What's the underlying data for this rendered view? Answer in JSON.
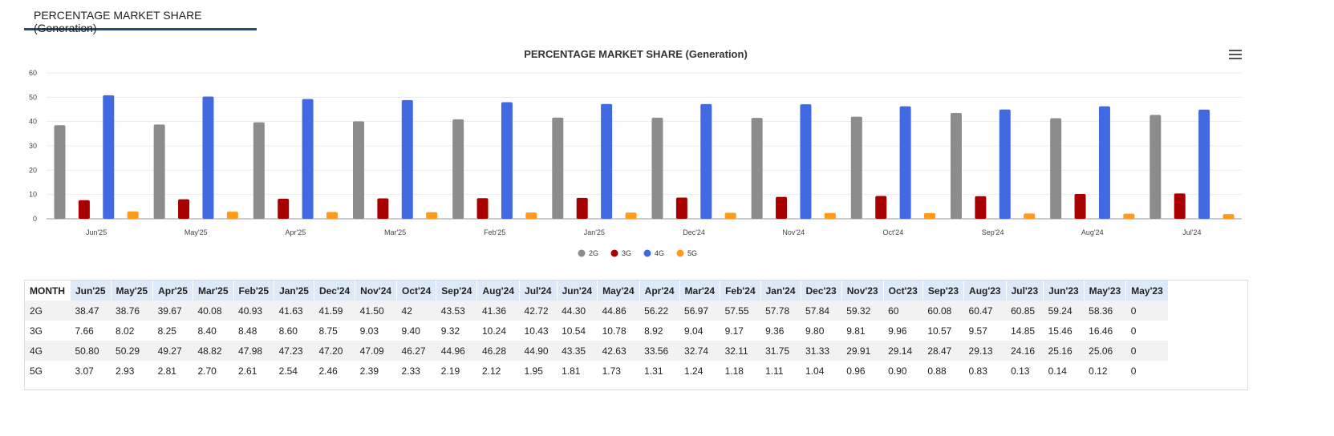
{
  "tab": {
    "label": "PERCENTAGE MARKET SHARE (Generation)"
  },
  "chart_data": {
    "type": "bar",
    "title": "PERCENTAGE MARKET SHARE (Generation)",
    "categories": [
      "Jun'25",
      "May'25",
      "Apr'25",
      "Mar'25",
      "Feb'25",
      "Jan'25",
      "Dec'24",
      "Nov'24",
      "Oct'24",
      "Sep'24",
      "Aug'24",
      "Jul'24"
    ],
    "series": [
      {
        "name": "2G",
        "color": "#8c8c8c",
        "values": [
          38.47,
          38.76,
          39.67,
          40.08,
          40.93,
          41.63,
          41.59,
          41.5,
          42,
          43.53,
          41.36,
          42.72
        ]
      },
      {
        "name": "3G",
        "color": "#a80000",
        "values": [
          7.66,
          8.02,
          8.25,
          8.4,
          8.48,
          8.6,
          8.75,
          9.03,
          9.4,
          9.32,
          10.24,
          10.43
        ]
      },
      {
        "name": "4G",
        "color": "#4169e1",
        "values": [
          50.8,
          50.29,
          49.27,
          48.82,
          47.98,
          47.23,
          47.2,
          47.09,
          46.27,
          44.96,
          46.28,
          44.9
        ]
      },
      {
        "name": "5G",
        "color": "#ff9a1a",
        "values": [
          3.07,
          2.93,
          2.81,
          2.7,
          2.61,
          2.54,
          2.46,
          2.39,
          2.33,
          2.19,
          2.12,
          1.95
        ]
      }
    ],
    "ylim": [
      0,
      60
    ],
    "yticks": [
      0,
      10,
      20,
      30,
      40,
      50,
      60
    ],
    "grid": true,
    "legend": "bottom-center"
  },
  "table": {
    "header": [
      "MONTH",
      "Jun'25",
      "May'25",
      "Apr'25",
      "Mar'25",
      "Feb'25",
      "Jan'25",
      "Dec'24",
      "Nov'24",
      "Oct'24",
      "Sep'24",
      "Aug'24",
      "Jul'24",
      "Jun'24",
      "May'24",
      "Apr'24",
      "Mar'24",
      "Feb'24",
      "Jan'24",
      "Dec'23",
      "Nov'23",
      "Oct'23",
      "Sep'23",
      "Aug'23",
      "Jul'23",
      "Jun'23",
      "May'23",
      "May'23"
    ],
    "rows": [
      [
        "2G",
        "38.47",
        "38.76",
        "39.67",
        "40.08",
        "40.93",
        "41.63",
        "41.59",
        "41.50",
        "42",
        "43.53",
        "41.36",
        "42.72",
        "44.30",
        "44.86",
        "56.22",
        "56.97",
        "57.55",
        "57.78",
        "57.84",
        "59.32",
        "60",
        "60.08",
        "60.47",
        "60.85",
        "59.24",
        "58.36",
        "0"
      ],
      [
        "3G",
        "7.66",
        "8.02",
        "8.25",
        "8.40",
        "8.48",
        "8.60",
        "8.75",
        "9.03",
        "9.40",
        "9.32",
        "10.24",
        "10.43",
        "10.54",
        "10.78",
        "8.92",
        "9.04",
        "9.17",
        "9.36",
        "9.80",
        "9.81",
        "9.96",
        "10.57",
        "9.57",
        "14.85",
        "15.46",
        "16.46",
        "0"
      ],
      [
        "4G",
        "50.80",
        "50.29",
        "49.27",
        "48.82",
        "47.98",
        "47.23",
        "47.20",
        "47.09",
        "46.27",
        "44.96",
        "46.28",
        "44.90",
        "43.35",
        "42.63",
        "33.56",
        "32.74",
        "32.11",
        "31.75",
        "31.33",
        "29.91",
        "29.14",
        "28.47",
        "29.13",
        "24.16",
        "25.16",
        "25.06",
        "0"
      ],
      [
        "5G",
        "3.07",
        "2.93",
        "2.81",
        "2.70",
        "2.61",
        "2.54",
        "2.46",
        "2.39",
        "2.33",
        "2.19",
        "2.12",
        "1.95",
        "1.81",
        "1.73",
        "1.31",
        "1.24",
        "1.18",
        "1.11",
        "1.04",
        "0.96",
        "0.90",
        "0.88",
        "0.83",
        "0.13",
        "0.14",
        "0.12",
        "0"
      ]
    ]
  }
}
